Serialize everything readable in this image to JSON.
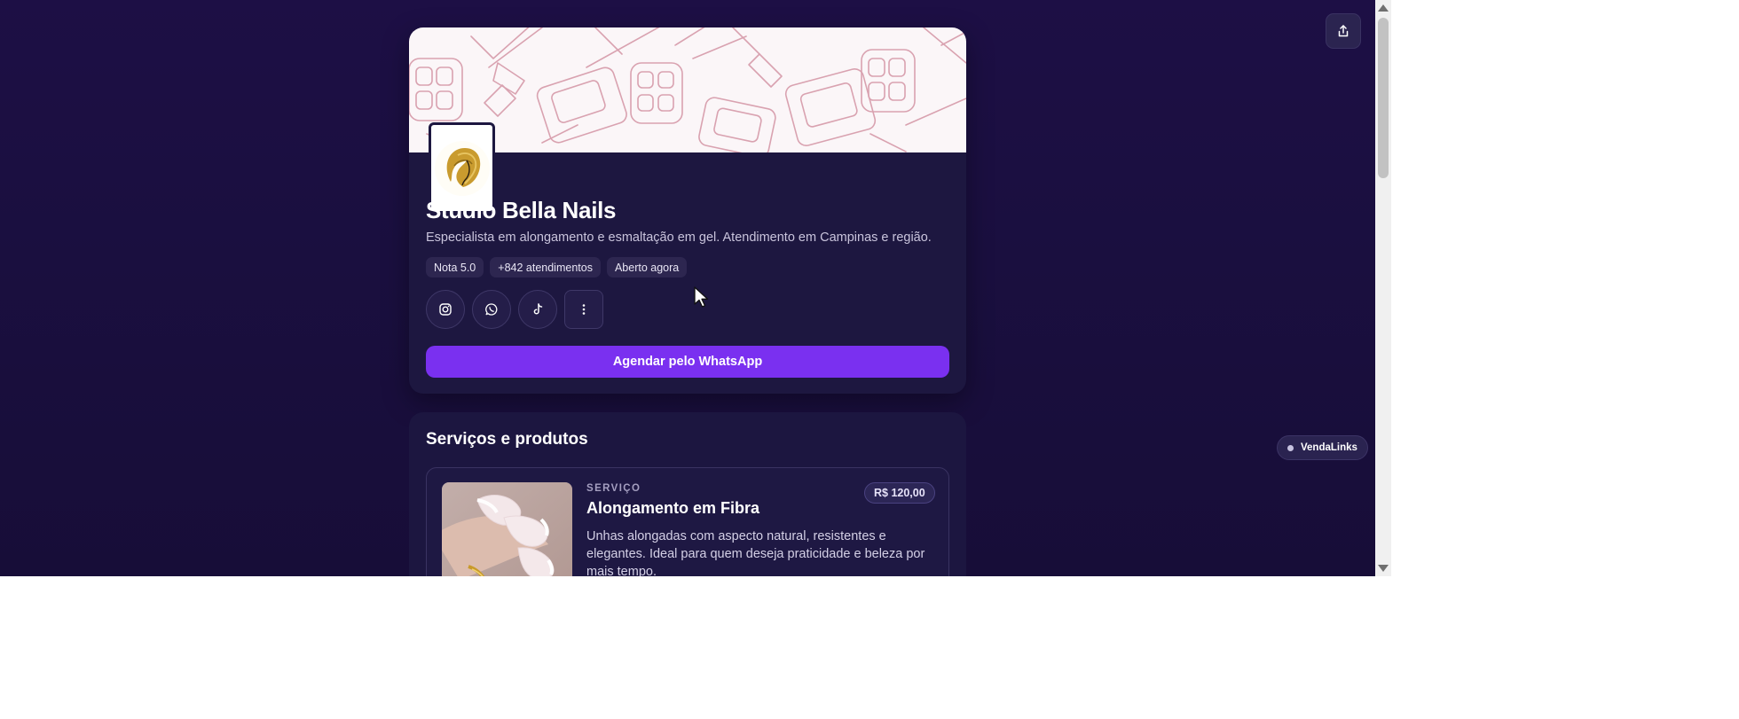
{
  "profile": {
    "name": "Studio Bella Nails",
    "bio": "Especialista em alongamento e esmaltação em gel. Atendimento em Campinas e região.",
    "badges": [
      "Nota 5.0",
      "+842 atendimentos",
      "Aberto agora"
    ],
    "socials": [
      {
        "icon": "instagram-icon"
      },
      {
        "icon": "whatsapp-icon"
      },
      {
        "icon": "tiktok-icon"
      },
      {
        "icon": "more-vertical-icon"
      }
    ],
    "cta_label": "Agendar pelo WhatsApp"
  },
  "services": {
    "title": "Serviços e produtos",
    "items": [
      {
        "kicker": "SERVIÇO",
        "name": "Alongamento em Fibra",
        "price": "R$ 120,00",
        "description": "Unhas alongadas com aspecto natural, resistentes e elegantes. Ideal para quem deseja praticidade e beleza por mais tempo."
      }
    ]
  },
  "brand": {
    "label": "VendaLinks"
  },
  "header": {
    "share_icon": "share-icon"
  },
  "colors": {
    "background": "#1c0f42",
    "card": "#1d1740",
    "accent": "#7a30f0",
    "badge": "#2d2650"
  }
}
